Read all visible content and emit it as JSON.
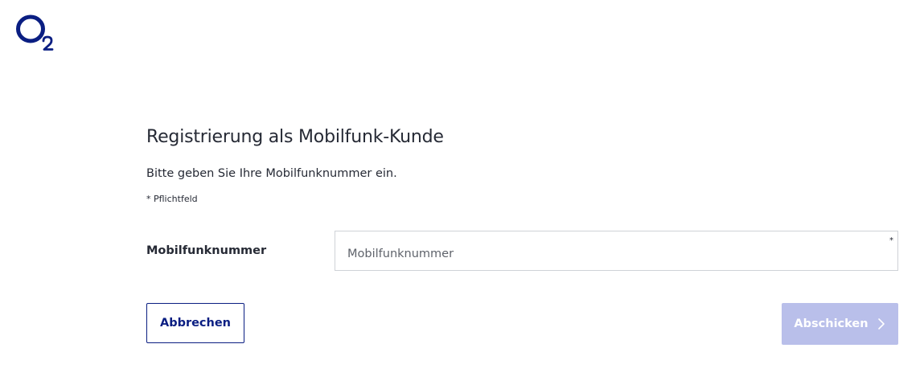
{
  "brand": {
    "logo_name": "O2",
    "primary_color": "#0a1e82",
    "disabled_color": "#b9bfea"
  },
  "page": {
    "title": "Registrierung als Mobilfunk-Kunde",
    "intro": "Bitte geben Sie Ihre Mobilfunknummer ein.",
    "required_note": "* Pflichtfeld"
  },
  "form": {
    "phone": {
      "label": "Mobilfunknummer",
      "placeholder": "Mobilfunknummer",
      "value": "",
      "required_marker": "*"
    }
  },
  "actions": {
    "cancel_label": "Abbrechen",
    "submit_label": "Abschicken",
    "submit_icon": "chevron-right-icon",
    "submit_disabled": true
  }
}
